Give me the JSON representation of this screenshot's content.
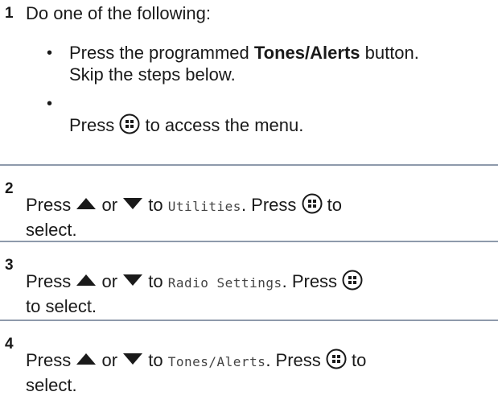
{
  "steps": [
    {
      "number": "1",
      "intro": "Do one of the following:",
      "option_1": {
        "before": "Press the programmed ",
        "bold": "Tones/Alerts",
        "after": " button.",
        "line2": "Skip the steps below."
      },
      "option_2": {
        "before": "Press ",
        "after": " to access the menu."
      }
    },
    {
      "number": "2",
      "press": "Press ",
      "or": " or ",
      "to": " to ",
      "target": "Utilities",
      "after": ". Press ",
      "to2": " to",
      "line2": "select."
    },
    {
      "number": "3",
      "press": "Press ",
      "or": " or ",
      "to": " to ",
      "target": "Radio Settings",
      "after": ". Press ",
      "line2": "to select."
    },
    {
      "number": "4",
      "press": "Press ",
      "or": " or ",
      "to": " to ",
      "target": "Tones/Alerts",
      "after": ". Press ",
      "to2": " to",
      "line2": "select."
    }
  ],
  "icons": {
    "menu": "menu-ok-button-icon",
    "up": "up-arrow-icon",
    "down": "down-arrow-icon"
  },
  "colors": {
    "separator": "#8e9aab",
    "text": "#1a1a1a"
  }
}
